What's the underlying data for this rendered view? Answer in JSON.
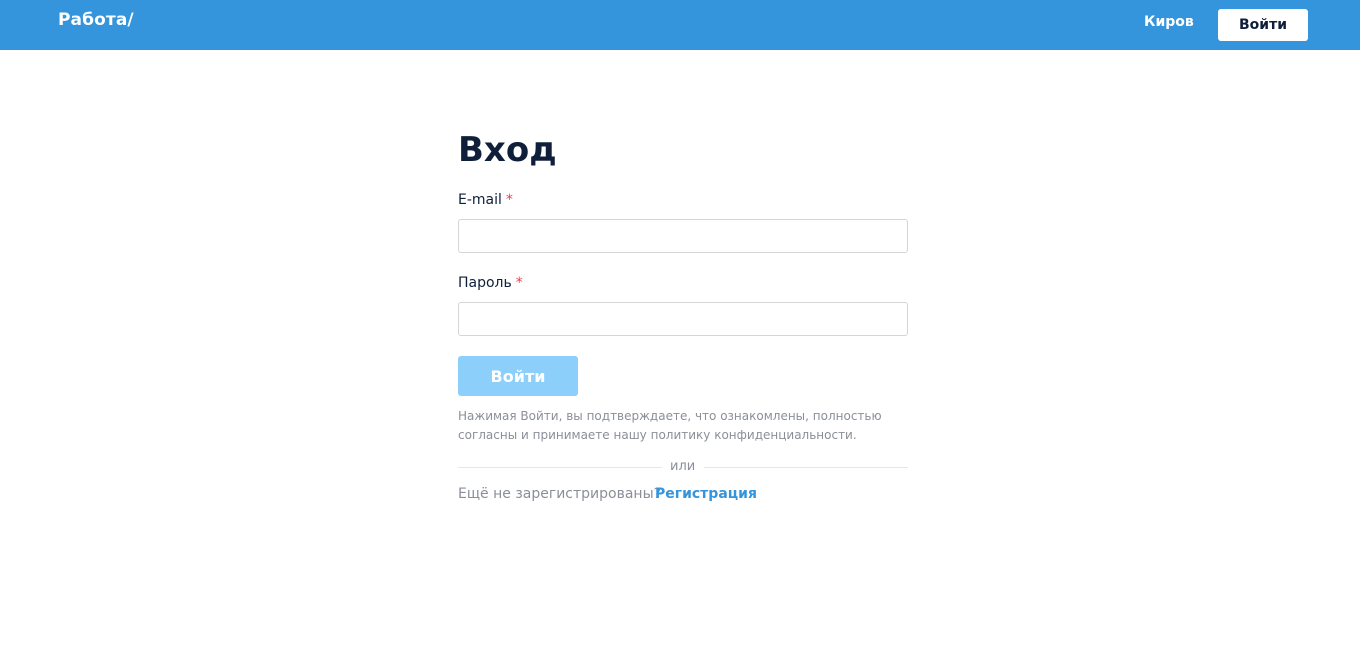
{
  "header": {
    "logo_text": "Работа/",
    "city": "Киров",
    "login_button": "Войти",
    "background_color": "#3494dc"
  },
  "form": {
    "title": "Вход",
    "email_label": "E-mail",
    "password_label": "Пароль",
    "required_marker": "*",
    "submit_button": "Войти",
    "policy_text": "Нажимая Войти, вы подтверждаете, что ознакомлены, полностью согласны и принимаете нашу политику конфиденциальности.",
    "divider_text": "или",
    "signup_prompt": "Ещё не зарегистрированы?",
    "signup_link": "Регистрация"
  }
}
